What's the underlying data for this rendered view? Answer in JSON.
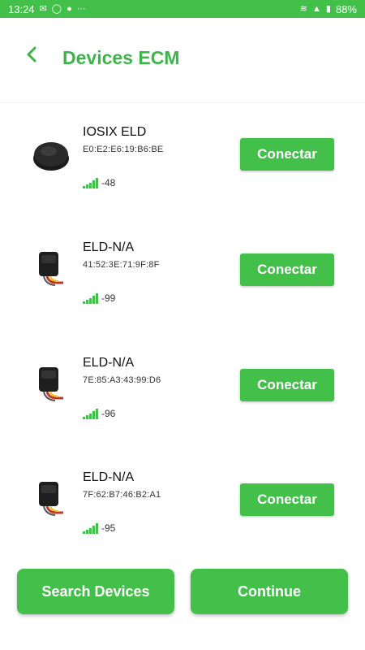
{
  "status_bar": {
    "time": "13:24",
    "left_icons": [
      "message-icon",
      "whatsapp-icon",
      "messenger-icon",
      "more-icon"
    ],
    "right_icons": [
      "wifi-icon",
      "signal-icon"
    ],
    "battery": "88%"
  },
  "header": {
    "title": "Devices ECM",
    "back_icon": "chevron-left-icon"
  },
  "devices": [
    {
      "name": "IOSIX ELD",
      "mac": "E0:E2:E6:19:B6:BE",
      "rssi": "-48",
      "button": "Conectar",
      "image": "round-puck-device"
    },
    {
      "name": "ELD-N/A",
      "mac": "41:52:3E:71:9F:8F",
      "rssi": "-99",
      "button": "Conectar",
      "image": "obd-box-device"
    },
    {
      "name": "ELD-N/A",
      "mac": "7E:85:A3:43:99:D6",
      "rssi": "-96",
      "button": "Conectar",
      "image": "obd-box-device"
    },
    {
      "name": "ELD-N/A",
      "mac": "7F:62:B7:46:B2:A1",
      "rssi": "-95",
      "button": "Conectar",
      "image": "obd-box-device"
    }
  ],
  "footer": {
    "search_label": "Search Devices",
    "continue_label": "Continue"
  },
  "colors": {
    "accent": "#43c04a",
    "title": "#3bb548"
  }
}
